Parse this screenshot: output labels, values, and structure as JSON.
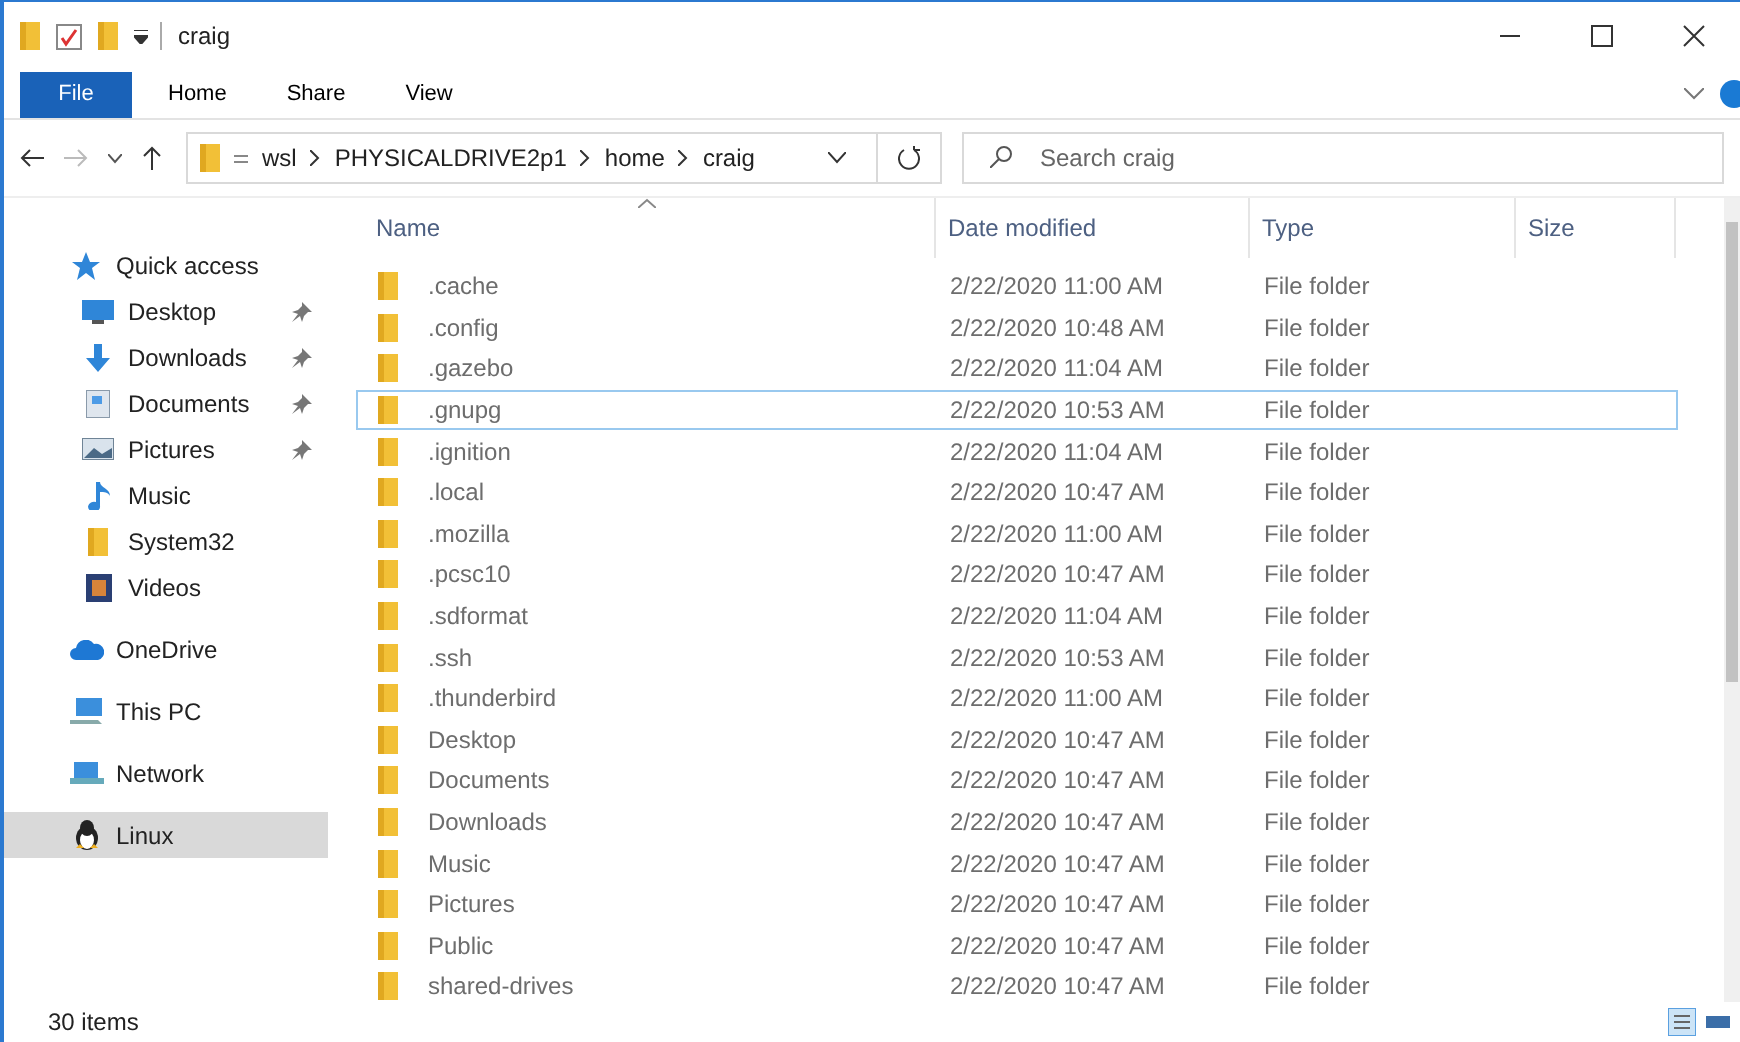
{
  "window": {
    "title": "craig"
  },
  "ribbon": {
    "file_tab": "File",
    "tabs": [
      {
        "label": "Home",
        "selected": false
      },
      {
        "label": "Share",
        "selected": false
      },
      {
        "label": "View",
        "selected": false
      }
    ]
  },
  "address": {
    "path": [
      "wsl",
      "PHYSICALDRIVE2p1",
      "home",
      "craig"
    ],
    "search": {
      "placeholder": "Search craig"
    }
  },
  "sidebar": {
    "items": [
      {
        "label": "Quick access",
        "kind": "group",
        "selected": false
      },
      {
        "label": "Desktop",
        "kind": "item",
        "pinned": true,
        "selected": false
      },
      {
        "label": "Downloads",
        "kind": "item",
        "pinned": true,
        "selected": false
      },
      {
        "label": "Documents",
        "kind": "item",
        "pinned": true,
        "selected": false
      },
      {
        "label": "Pictures",
        "kind": "item",
        "pinned": true,
        "selected": false
      },
      {
        "label": "Music",
        "kind": "item",
        "pinned": false,
        "selected": false
      },
      {
        "label": "System32",
        "kind": "item",
        "pinned": false,
        "selected": false
      },
      {
        "label": "Videos",
        "kind": "item",
        "pinned": false,
        "selected": false
      },
      {
        "label": "OneDrive",
        "kind": "group",
        "selected": false
      },
      {
        "label": "This PC",
        "kind": "group",
        "selected": false
      },
      {
        "label": "Network",
        "kind": "group",
        "selected": false
      },
      {
        "label": "Linux",
        "kind": "group",
        "selected": true
      }
    ]
  },
  "table": {
    "columns": [
      "Name",
      "Date modified",
      "Type",
      "Size"
    ],
    "rows": [
      {
        "name": ".cache",
        "date": "2/22/2020 11:00 AM",
        "type": "File folder",
        "selected": false
      },
      {
        "name": ".config",
        "date": "2/22/2020 10:48 AM",
        "type": "File folder",
        "selected": false
      },
      {
        "name": ".gazebo",
        "date": "2/22/2020 11:04 AM",
        "type": "File folder",
        "selected": false
      },
      {
        "name": ".gnupg",
        "date": "2/22/2020 10:53 AM",
        "type": "File folder",
        "selected": true
      },
      {
        "name": ".ignition",
        "date": "2/22/2020 11:04 AM",
        "type": "File folder",
        "selected": false
      },
      {
        "name": ".local",
        "date": "2/22/2020 10:47 AM",
        "type": "File folder",
        "selected": false
      },
      {
        "name": ".mozilla",
        "date": "2/22/2020 11:00 AM",
        "type": "File folder",
        "selected": false
      },
      {
        "name": ".pcsc10",
        "date": "2/22/2020 10:47 AM",
        "type": "File folder",
        "selected": false
      },
      {
        "name": ".sdformat",
        "date": "2/22/2020 11:04 AM",
        "type": "File folder",
        "selected": false
      },
      {
        "name": ".ssh",
        "date": "2/22/2020 10:53 AM",
        "type": "File folder",
        "selected": false
      },
      {
        "name": ".thunderbird",
        "date": "2/22/2020 11:00 AM",
        "type": "File folder",
        "selected": false
      },
      {
        "name": "Desktop",
        "date": "2/22/2020 10:47 AM",
        "type": "File folder",
        "selected": false
      },
      {
        "name": "Documents",
        "date": "2/22/2020 10:47 AM",
        "type": "File folder",
        "selected": false
      },
      {
        "name": "Downloads",
        "date": "2/22/2020 10:47 AM",
        "type": "File folder",
        "selected": false
      },
      {
        "name": "Music",
        "date": "2/22/2020 10:47 AM",
        "type": "File folder",
        "selected": false
      },
      {
        "name": "Pictures",
        "date": "2/22/2020 10:47 AM",
        "type": "File folder",
        "selected": false
      },
      {
        "name": "Public",
        "date": "2/22/2020 10:47 AM",
        "type": "File folder",
        "selected": false
      },
      {
        "name": "shared-drives",
        "date": "2/22/2020 10:47 AM",
        "type": "File folder",
        "selected": false
      }
    ]
  },
  "status_bar": {
    "count": "30 items"
  }
}
